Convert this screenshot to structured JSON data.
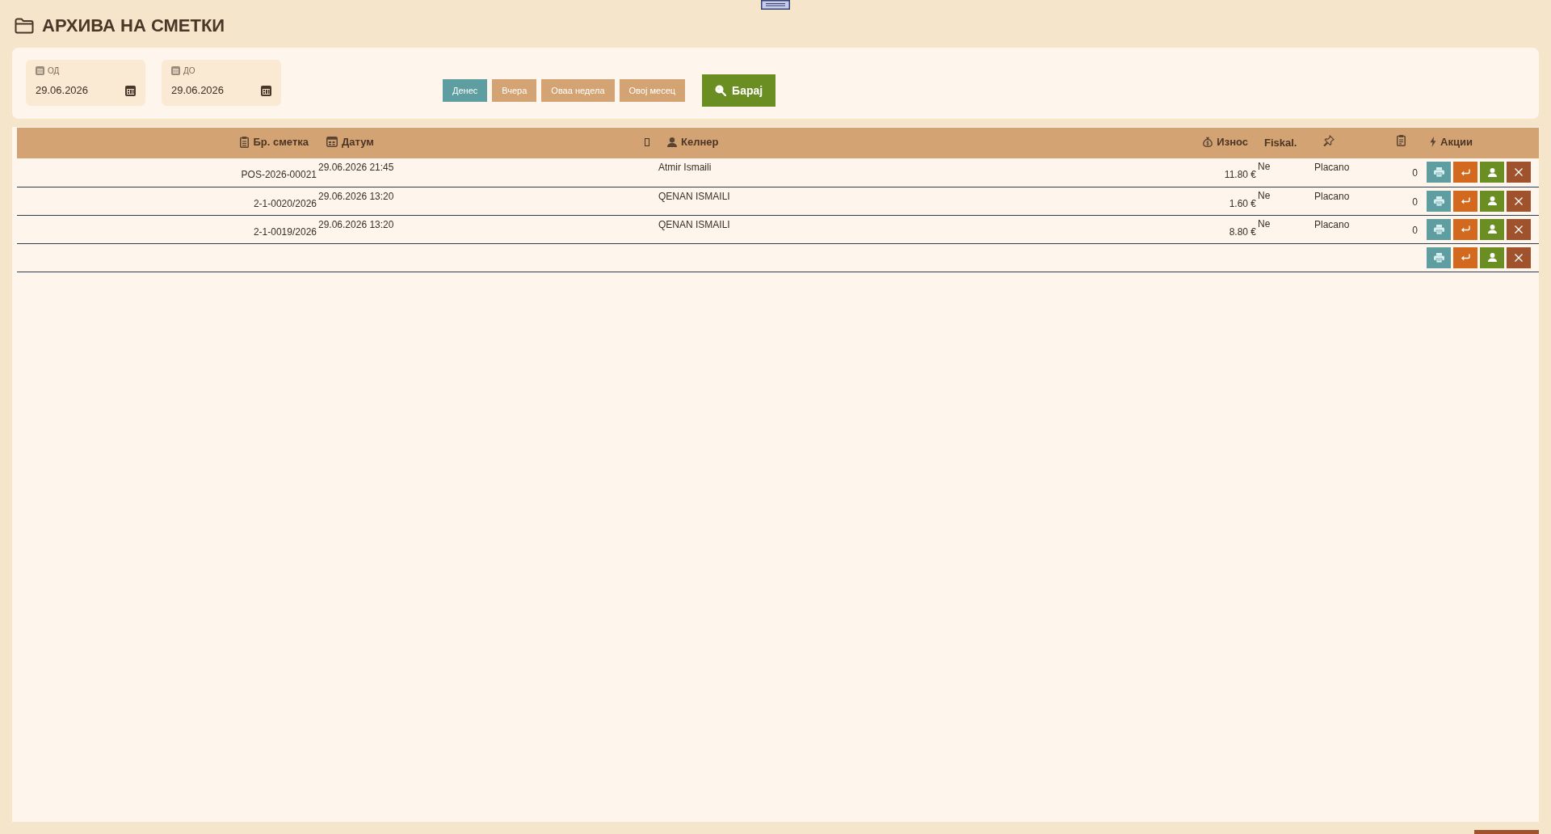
{
  "page_title": "АРХИВА НА СМЕТКИ",
  "filters": {
    "date_fields": [
      {
        "label": "ОД",
        "value": "29.06.2026"
      },
      {
        "label": "ДО",
        "value": "29.06.2026"
      }
    ],
    "quick_ranges": [
      {
        "label": "Денес",
        "selected": true
      },
      {
        "label": "Вчера",
        "selected": false
      },
      {
        "label": "Оваа недела",
        "selected": false
      },
      {
        "label": "Овој месец",
        "selected": false
      }
    ],
    "search_button": "Барај"
  },
  "table": {
    "columns": [
      {
        "kind": "labeled",
        "label": "Бр. сметка"
      },
      {
        "kind": "labeled",
        "label": "Датум"
      },
      {
        "kind": "icon"
      },
      {
        "kind": "labeled",
        "label": "Келнер"
      },
      {
        "kind": "labeled",
        "label": "Износ"
      },
      {
        "kind": "labeled",
        "label": "Fiskal."
      },
      {
        "kind": "icon"
      },
      {
        "kind": "icon"
      },
      {
        "kind": "labeled",
        "label": "Акции"
      }
    ],
    "rows": [
      {
        "kind": "bill",
        "bill_no": "POS-2026-00021",
        "date": "29.06.2026 21:45",
        "waiter": "Atmir Ismaili",
        "amount": "11.80 €",
        "fiskal": "Ne",
        "column_7": "Placano",
        "column_8": "0"
      },
      {
        "kind": "bill",
        "bill_no": "2-1-0020/2026",
        "date": "29.06.2026 13:20",
        "waiter": "QENAN ISMAILI",
        "amount": "1.60 €",
        "fiskal": "Ne",
        "column_7": "Placano",
        "column_8": "0"
      },
      {
        "kind": "bill",
        "bill_no": "2-1-0019/2026",
        "date": "29.06.2026 13:20",
        "waiter": "QENAN ISMAILI",
        "amount": "8.80 €",
        "fiskal": "Ne",
        "column_7": "Placano",
        "column_8": "0"
      },
      {
        "kind": "empty"
      }
    ]
  }
}
